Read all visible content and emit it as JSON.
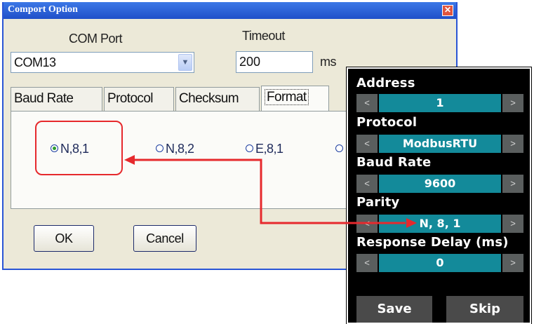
{
  "dialog": {
    "title": "Comport Option",
    "close_glyph": "✕",
    "com_port_label": "COM Port",
    "com_port_value": "COM13",
    "timeout_label": "Timeout",
    "timeout_value": "200",
    "timeout_unit": "ms",
    "tabs": [
      {
        "label": "Baud Rate"
      },
      {
        "label": "Protocol"
      },
      {
        "label": "Checksum"
      },
      {
        "label": "Format",
        "active": true
      }
    ],
    "format_options": [
      {
        "label": "N,8,1",
        "selected": true
      },
      {
        "label": "N,8,2",
        "selected": false
      },
      {
        "label": "E,8,1",
        "selected": false
      }
    ],
    "ok_label": "OK",
    "cancel_label": "Cancel"
  },
  "device": {
    "prev_glyph": "<",
    "next_glyph": ">",
    "fields": [
      {
        "label": "Address",
        "value": "1"
      },
      {
        "label": "Protocol",
        "value": "ModbusRTU"
      },
      {
        "label": "Baud Rate",
        "value": "9600"
      },
      {
        "label": "Parity",
        "value": "N, 8, 1"
      },
      {
        "label": "Response Delay (ms)",
        "value": "0"
      }
    ],
    "save_label": "Save",
    "skip_label": "Skip"
  },
  "colors": {
    "highlight": "#e6292d",
    "device_value_bg": "#138a9a",
    "titlebar": "#2a5bd7"
  }
}
